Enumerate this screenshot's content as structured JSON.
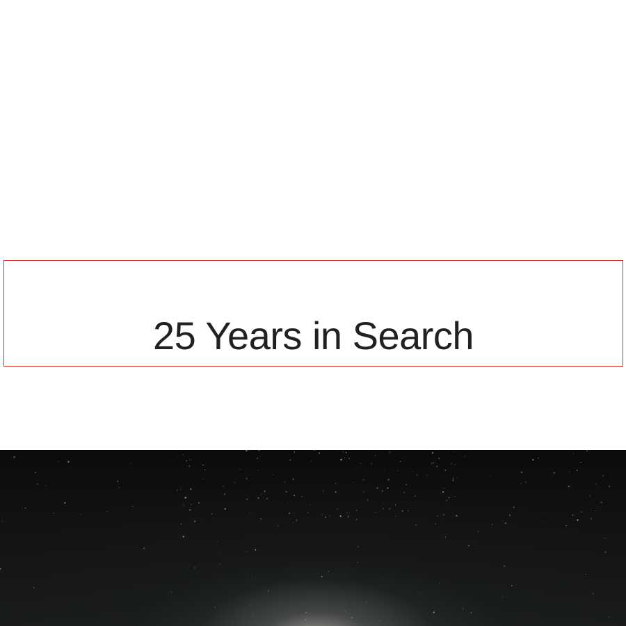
{
  "heading": {
    "title": "25 Years in Search"
  },
  "colors": {
    "background": "#ffffff",
    "title_text": "#202124",
    "highlight_border": "#d93025",
    "hero_dark": "#0b0b0b"
  },
  "hero": {
    "icon": "starfield-image"
  }
}
